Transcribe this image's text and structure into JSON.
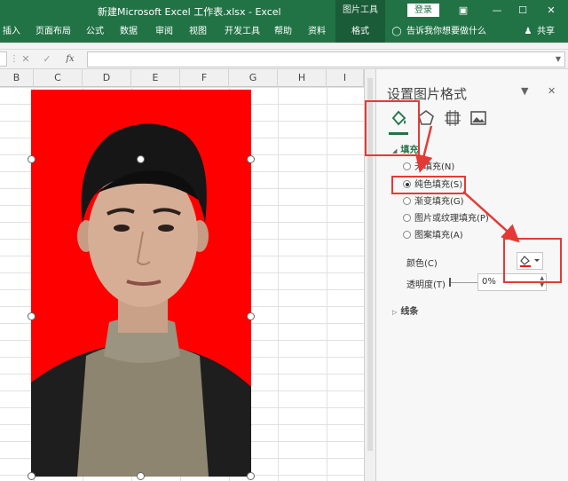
{
  "window": {
    "title": "新建Microsoft Excel 工作表.xlsx  -  Excel",
    "context_tab": "图片工具",
    "login_label": "登录",
    "controls": [
      "ribbon-display-icon",
      "minimize-icon",
      "maximize-icon",
      "close-icon"
    ]
  },
  "ribbon": {
    "tabs": [
      "插入",
      "页面布局",
      "公式",
      "数据",
      "审阅",
      "视图",
      "开发工具",
      "帮助",
      "资料",
      "格式"
    ],
    "active_tab": "格式",
    "tell_me": "告诉我你想要做什么",
    "share": "共享"
  },
  "formula_bar": {
    "cancel_symbol": "✕",
    "enter_symbol": "✓",
    "fx_label": "fx",
    "value": ""
  },
  "sheet": {
    "columns": [
      "B",
      "C",
      "D",
      "E",
      "F",
      "G",
      "H",
      "I"
    ],
    "picture": {
      "background_color": "#ff0000",
      "description_icon": "portrait-photo"
    }
  },
  "pane": {
    "title": "设置图片格式",
    "category_icons": [
      "fill-line-icon",
      "effects-pentagon-icon",
      "size-properties-icon",
      "picture-icon"
    ],
    "active_category": "fill-line-icon",
    "fill_section": {
      "heading": "填充",
      "options": [
        {
          "label": "无填充(N)",
          "selected": false
        },
        {
          "label": "纯色填充(S)",
          "selected": true
        },
        {
          "label": "渐变填充(G)",
          "selected": false
        },
        {
          "label": "图片或纹理填充(P)",
          "selected": false
        },
        {
          "label": "图案填充(A)",
          "selected": false
        }
      ],
      "color_label": "颜色(C)",
      "color_value": "#ff0000",
      "transparency_label": "透明度(T)",
      "transparency_value": "0%"
    },
    "line_section": {
      "heading": "线条"
    }
  },
  "colors": {
    "excel_green": "#217346",
    "annotation_red": "#e53935"
  }
}
